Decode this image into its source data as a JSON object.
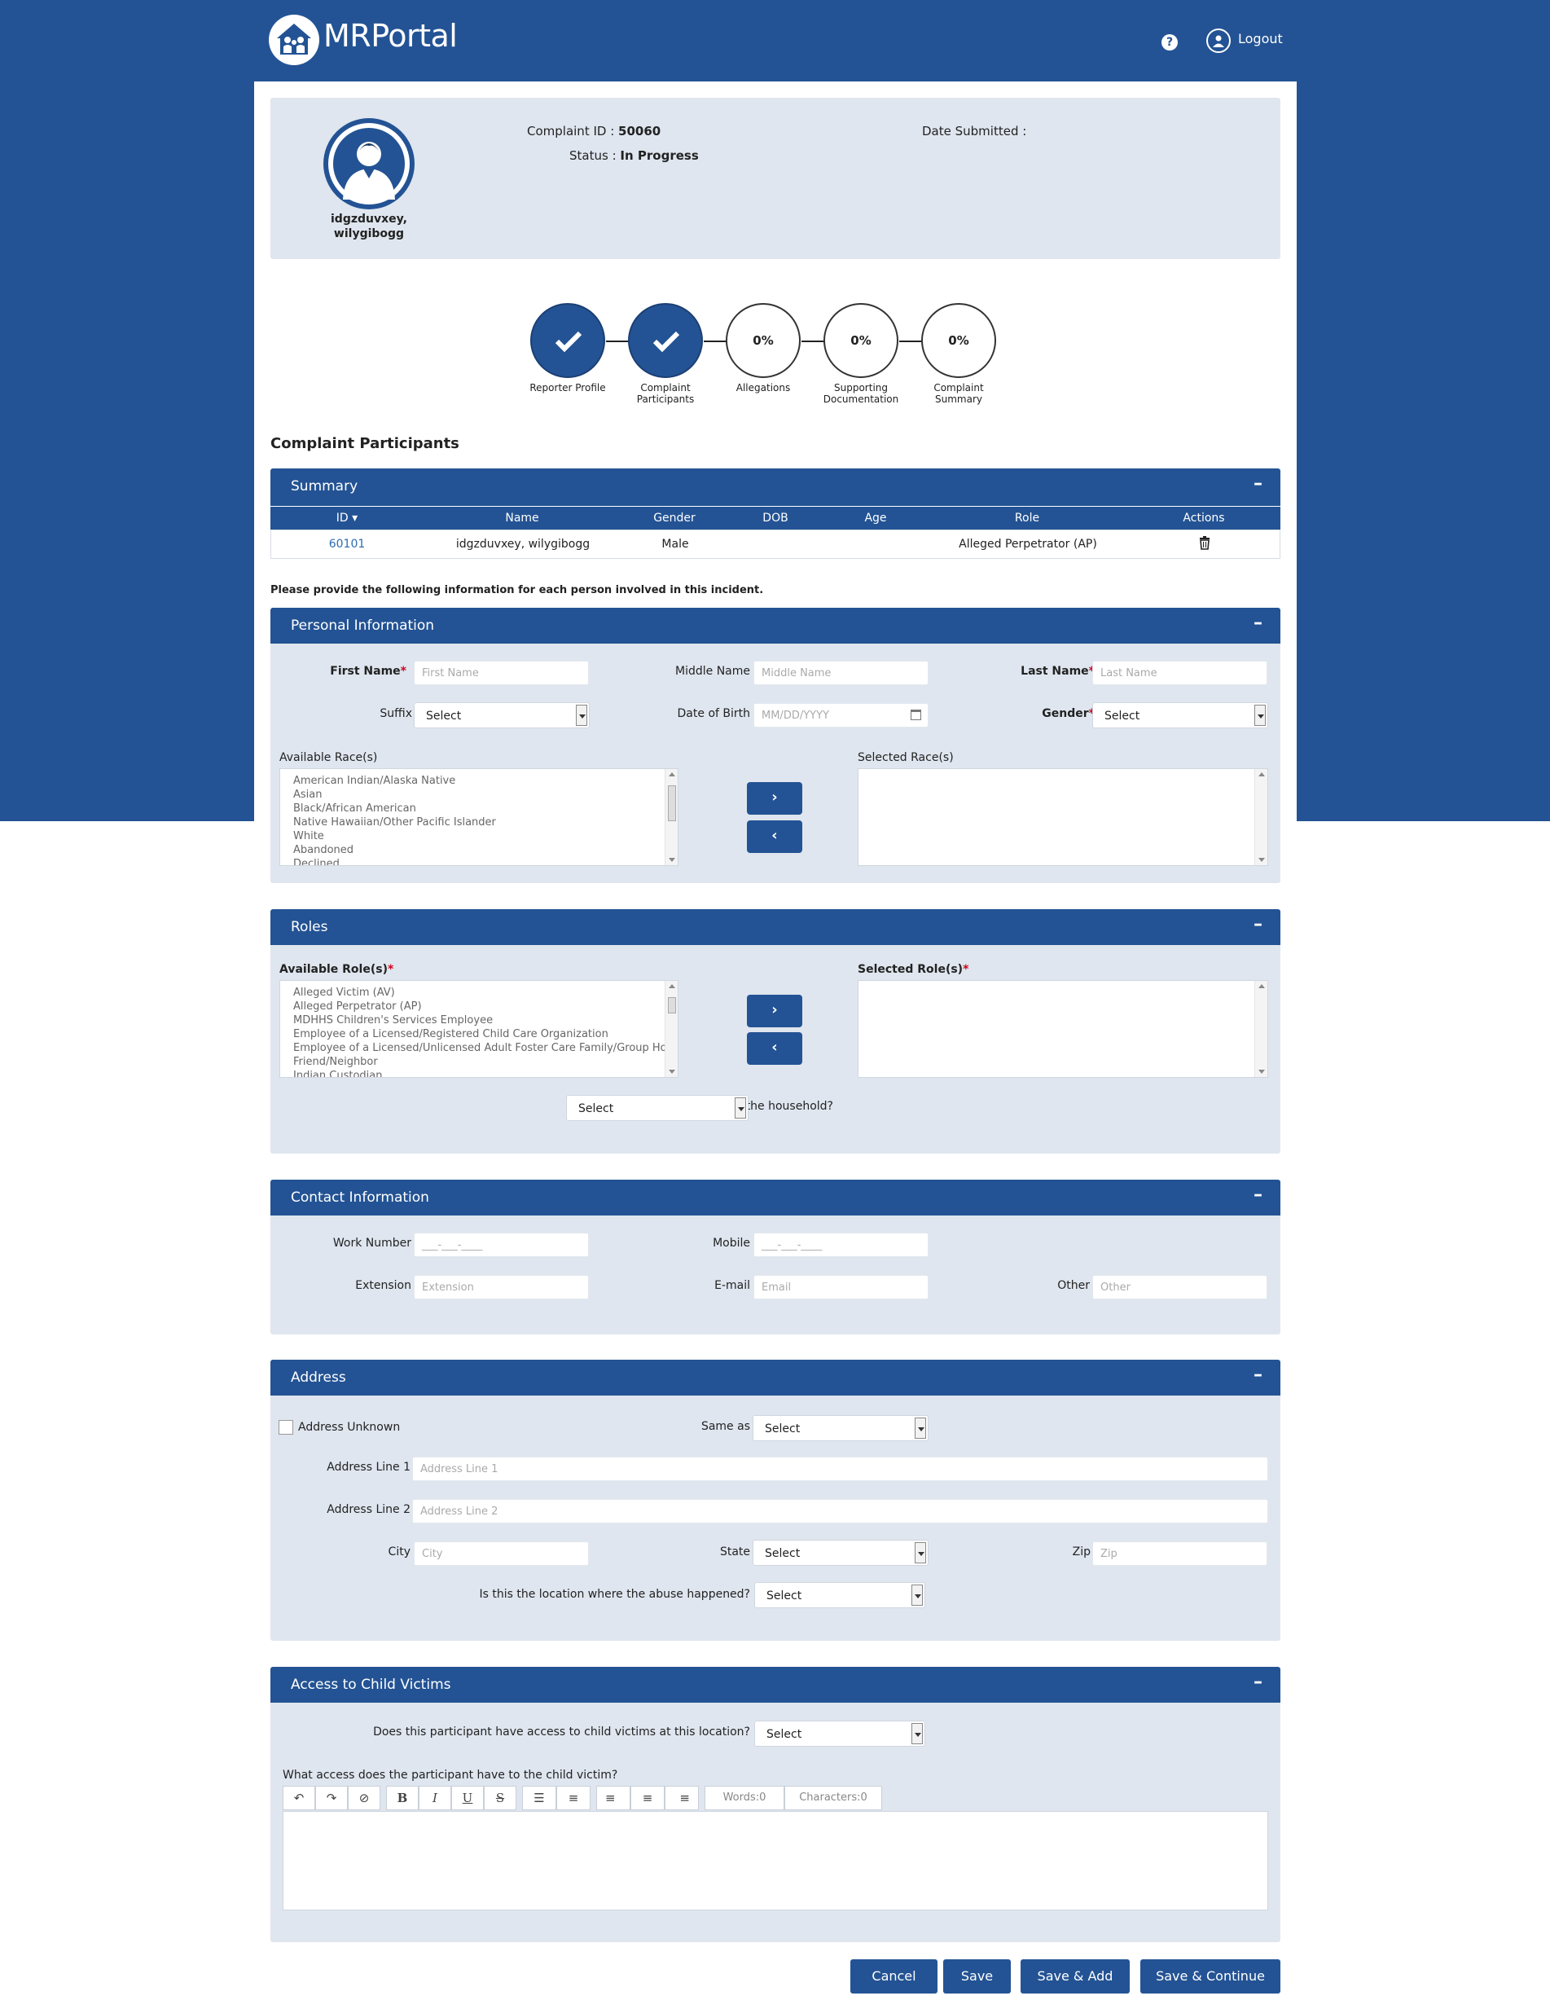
{
  "app": {
    "title": "MRPortal",
    "logout_label": "Logout",
    "help_glyph": "?"
  },
  "profile": {
    "complaint_id_label": "Complaint ID :",
    "complaint_id": "50060",
    "status_label": "Status :",
    "status": "In Progress",
    "date_submitted_label": "Date Submitted :",
    "user_name_line1": "idgzduvxey,",
    "user_name_line2": "wilygibogg"
  },
  "steps": [
    {
      "label_line1": "Reporter Profile",
      "label_line2": "",
      "state": "done",
      "text": ""
    },
    {
      "label_line1": "Complaint",
      "label_line2": "Participants",
      "state": "done",
      "text": ""
    },
    {
      "label_line1": "Allegations",
      "label_line2": "",
      "state": "todo",
      "text": "0%"
    },
    {
      "label_line1": "Supporting",
      "label_line2": "Documentation",
      "state": "todo",
      "text": "0%"
    },
    {
      "label_line1": "Complaint",
      "label_line2": "Summary",
      "state": "todo",
      "text": "0%"
    }
  ],
  "section_title": "Complaint Participants",
  "summary": {
    "title": "Summary",
    "toggle": "–",
    "columns": [
      "ID",
      "Name",
      "Gender",
      "DOB",
      "Age",
      "Role",
      "Actions"
    ],
    "rows": [
      {
        "id": "60101",
        "name": "idgzduvxey, wilygibogg",
        "gender": "Male",
        "dob": "",
        "age": "",
        "role": "Alleged Perpetrator (AP)"
      }
    ]
  },
  "instruction": "Please provide the following information for each person involved in this incident.",
  "personal": {
    "title": "Personal Information",
    "toggle": "–",
    "first_name_label": "First Name",
    "first_name_placeholder": "First Name",
    "middle_name_label": "Middle Name",
    "middle_name_placeholder": "Middle Name",
    "last_name_label": "Last Name",
    "last_name_placeholder": "Last Name",
    "suffix_label": "Suffix",
    "suffix_value": "Select",
    "dob_label": "Date of Birth",
    "dob_placeholder": "MM/DD/YYYY",
    "gender_label": "Gender",
    "gender_value": "Select",
    "available_races_label": "Available Race(s)",
    "selected_races_label": "Selected Race(s)",
    "available_races": [
      "American Indian/Alaska Native",
      "Asian",
      "Black/African American",
      "Native Hawaiian/Other Pacific Islander",
      "White",
      "Abandoned",
      "Declined"
    ],
    "move_right": "›",
    "move_left": "‹"
  },
  "roles": {
    "title": "Roles",
    "toggle": "–",
    "available_label": "Available Role(s)",
    "selected_label": "Selected Role(s)",
    "available": [
      "Alleged Victim (AV)",
      "Alleged Perpetrator (AP)",
      "MDHHS Children's Services Employee",
      "Employee of a Licensed/Registered Child Care Organization",
      "Employee of a Licensed/Unlicensed Adult Foster Care Family/Group Home",
      "Friend/Neighbor",
      "Indian Custodian"
    ],
    "household_label": "Is the person inside the household?",
    "household_value": "Select"
  },
  "contact": {
    "title": "Contact Information",
    "toggle": "–",
    "work_label": "Work Number",
    "work_placeholder": "___-___-____",
    "mobile_label": "Mobile",
    "mobile_placeholder": "___-___-____",
    "extension_label": "Extension",
    "extension_placeholder": "Extension",
    "email_label": "E-mail",
    "email_placeholder": "Email",
    "other_label": "Other",
    "other_placeholder": "Other"
  },
  "address": {
    "title": "Address",
    "toggle": "–",
    "unknown_label": "Address Unknown",
    "same_as_label": "Same as",
    "same_as_value": "Select",
    "line1_label": "Address Line 1",
    "line1_placeholder": "Address Line 1",
    "line2_label": "Address Line 2",
    "line2_placeholder": "Address Line 2",
    "city_label": "City",
    "city_placeholder": "City",
    "state_label": "State",
    "state_value": "Select",
    "zip_label": "Zip",
    "zip_placeholder": "Zip",
    "abuse_location_label": "Is this the location where the abuse happened?",
    "abuse_location_value": "Select"
  },
  "access": {
    "title": "Access to Child Victims",
    "toggle": "–",
    "question_label": "Does this participant have access to child victims at this location?",
    "question_value": "Select",
    "what_access_label": "What access does the participant have to the child victim?",
    "toolbar": {
      "undo": "↶",
      "redo": "↷",
      "clear": "⊘",
      "bold": "B",
      "italic": "I",
      "underline": "U",
      "strike": "S",
      "ul": "☰",
      "ol": "≡",
      "align_left": "≡",
      "align_center": "≡",
      "align_right": "≡",
      "words": "Words:0",
      "characters": "Characters:0"
    }
  },
  "actions": {
    "cancel": "Cancel",
    "save": "Save",
    "save_add": "Save & Add",
    "save_continue": "Save & Continue"
  },
  "colors": {
    "primary": "#235394",
    "panel_bg": "#dfe6ef",
    "required": "#d0021b"
  }
}
